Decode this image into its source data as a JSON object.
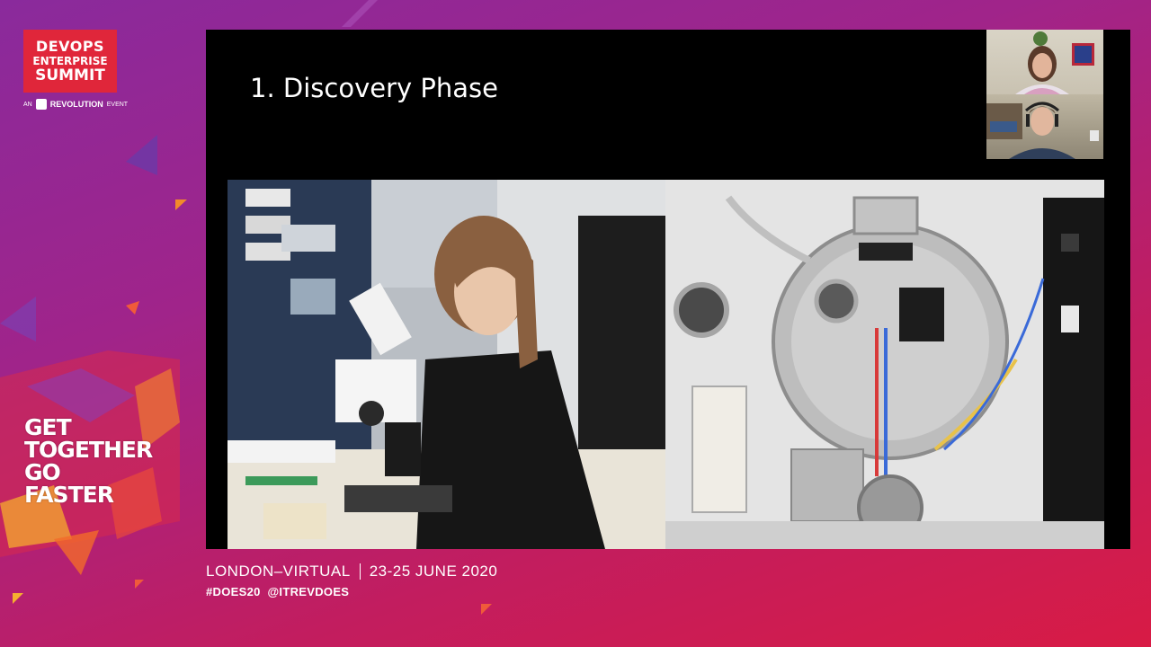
{
  "event": {
    "logo_line1": "DEVOPS",
    "logo_line2": "ENTERPRISE",
    "logo_line3": "SUMMIT",
    "org_prefix": "AN",
    "org_name": "REVOLUTION",
    "org_suffix": "EVENT",
    "tagline": [
      "GET",
      "TOGETHER",
      "GO",
      "FASTER"
    ]
  },
  "slide": {
    "title": "1. Discovery Phase",
    "photo_left_label": "Researcher using a microscope in a lab",
    "photo_right_label": "Vacuum chamber apparatus"
  },
  "footer": {
    "location": "LONDON–VIRTUAL",
    "dates": "23-25 JUNE 2020",
    "hashtags": "#DOES20  @ITREVDOES"
  },
  "colors": {
    "logo_red": "#e0263a",
    "bg_purple": "#8a2a9c",
    "bg_red": "#d81b45"
  }
}
